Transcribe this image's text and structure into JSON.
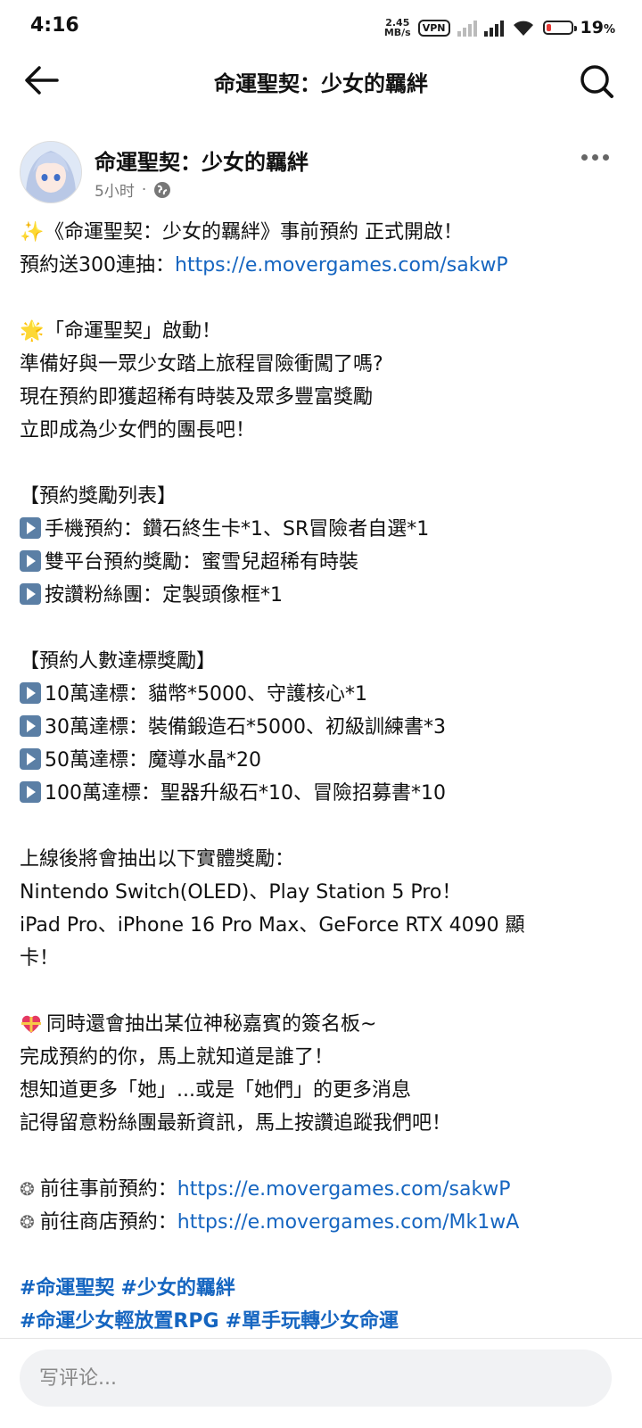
{
  "status_bar": {
    "time": "4:16",
    "speed_value": "2.45",
    "speed_unit": "MB/s",
    "vpn": "VPN",
    "battery_percent": "19",
    "battery_percent_symbol": "%",
    "battery_level": 0.19
  },
  "app_bar": {
    "title": "命運聖契：少女的羈絆",
    "back_icon": "arrow-left-icon",
    "search_icon": "search-icon"
  },
  "post": {
    "author": "命運聖契：少女的羈絆",
    "time": "5小时",
    "separator": "·",
    "audience_icon": "globe-icon",
    "lines": [
      {
        "emoji": "✨",
        "text": "《命運聖契：少女的羈絆》事前預約 正式開啟！"
      },
      {
        "text": "預約送300連抽：",
        "link": "https://e.movergames.com/sakwP"
      },
      {
        "blank": true
      },
      {
        "emoji": "🌟",
        "text": "「命運聖契」啟動！"
      },
      {
        "text": "準備好與一眾少女踏上旅程冒險衝闖了嗎?"
      },
      {
        "text": "現在預約即獲超稀有時裝及眾多豐富獎勵"
      },
      {
        "text": "立即成為少女們的團長吧！"
      },
      {
        "blank": true
      },
      {
        "text": "【預約獎勵列表】"
      },
      {
        "play": true,
        "text": "手機預約：鑽石終生卡*1、SR冒險者自選*1"
      },
      {
        "play": true,
        "text": "雙平台預約獎勵：蜜雪兒超稀有時裝"
      },
      {
        "play": true,
        "text": "按讚粉絲團：定製頭像框*1"
      },
      {
        "blank": true
      },
      {
        "text": "【預約人數達標獎勵】"
      },
      {
        "play": true,
        "text": "10萬達標：貓幣*5000、守護核心*1"
      },
      {
        "play": true,
        "text": "30萬達標：裝備鍛造石*5000、初級訓練書*3"
      },
      {
        "play": true,
        "text": "50萬達標：魔導水晶*20"
      },
      {
        "play": true,
        "text": "100萬達標：聖器升級石*10、冒險招募書*10"
      },
      {
        "blank": true
      },
      {
        "text": "上線後將會抽出以下實體獎勵："
      },
      {
        "text": "Nintendo Switch(OLED)、Play Station 5 Pro！"
      },
      {
        "text": "iPad Pro、iPhone 16 Pro Max、GeForce RTX 4090 顯"
      },
      {
        "text": "卡！"
      },
      {
        "blank": true
      },
      {
        "gift": true,
        "text": "同時還會抽出某位神秘嘉賓的簽名板~"
      },
      {
        "text": "完成預約的你，馬上就知道是誰了！"
      },
      {
        "text": "想知道更多「她」...或是「她們」的更多消息"
      },
      {
        "text": "記得留意粉絲團最新資訊，馬上按讚追蹤我們吧！"
      },
      {
        "blank": true
      },
      {
        "gear": "❂",
        "text": "前往事前預約：",
        "link": "https://e.movergames.com/sakwP"
      },
      {
        "gear": "❂",
        "text": "前往商店預約：",
        "link": "https://e.movergames.com/Mk1wA"
      },
      {
        "blank": true
      },
      {
        "hashtags": [
          "#命運聖契",
          "#少女的羈絆"
        ]
      },
      {
        "hashtags": [
          "#命運少女輕放置RPG",
          "#單手玩轉少女命運"
        ]
      }
    ]
  },
  "comment": {
    "placeholder": "写评论..."
  },
  "colors": {
    "link": "#1565c0",
    "battery_low": "#e53935"
  }
}
